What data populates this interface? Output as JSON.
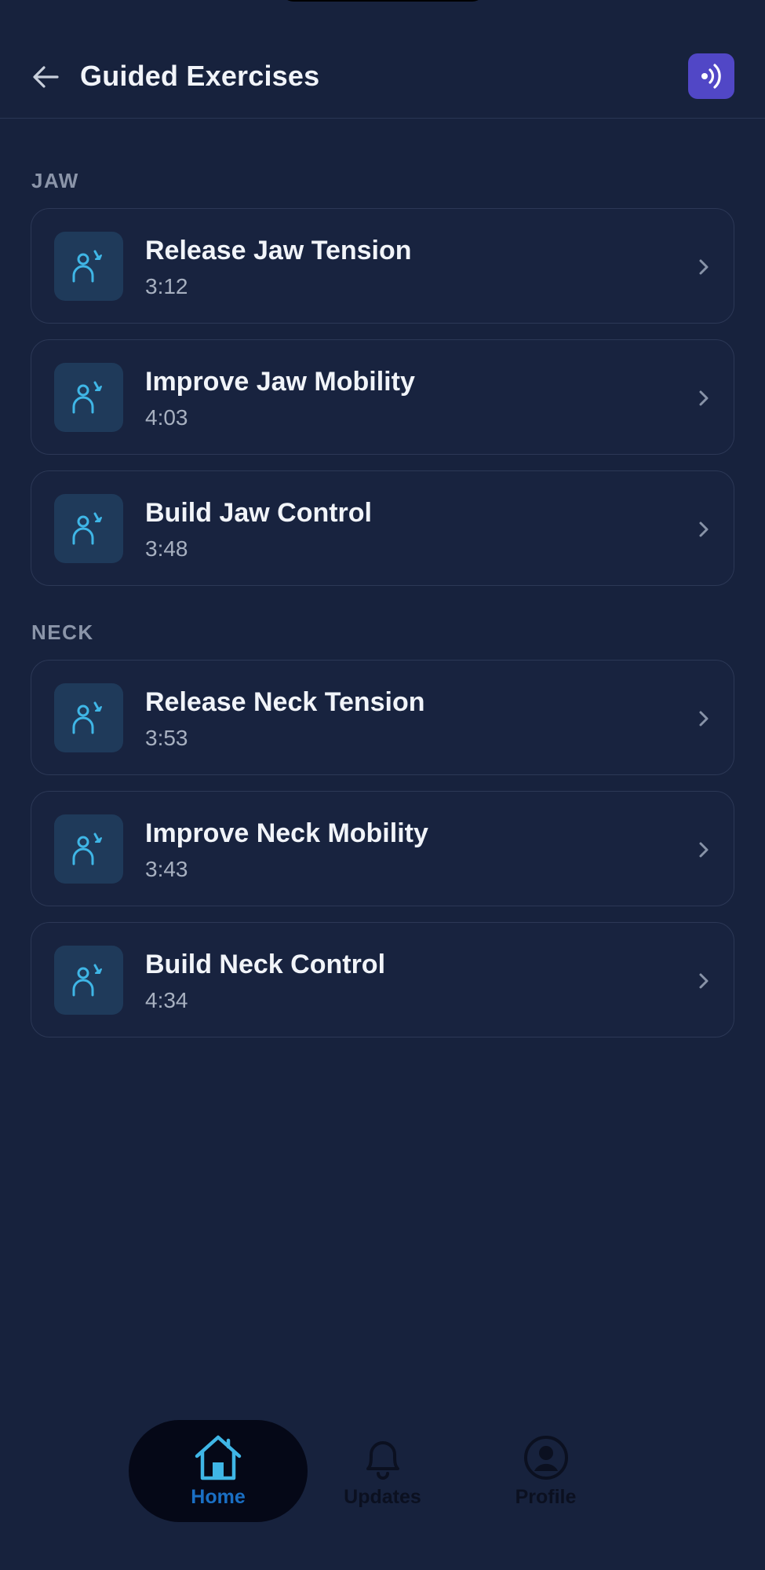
{
  "header": {
    "title": "Guided Exercises",
    "back_icon": "arrow-left-icon",
    "audio_icon": "audio-icon"
  },
  "sections": [
    {
      "label": "JAW",
      "items": [
        {
          "title": "Release Jaw Tension",
          "duration": "3:12"
        },
        {
          "title": "Improve Jaw Mobility",
          "duration": "4:03"
        },
        {
          "title": "Build Jaw Control",
          "duration": "3:48"
        }
      ]
    },
    {
      "label": "NECK",
      "items": [
        {
          "title": "Release Neck Tension",
          "duration": "3:53"
        },
        {
          "title": "Improve Neck Mobility",
          "duration": "3:43"
        },
        {
          "title": "Build Neck Control",
          "duration": "4:34"
        }
      ]
    }
  ],
  "tabbar": {
    "tabs": [
      {
        "label": "Home",
        "icon": "home-icon",
        "active": true
      },
      {
        "label": "Updates",
        "icon": "bell-icon",
        "active": false
      },
      {
        "label": "Profile",
        "icon": "profile-icon",
        "active": false
      }
    ]
  },
  "colors": {
    "background": "#17223d",
    "accent_purple": "#5147c6",
    "accent_cyan": "#3fb6e6",
    "active_tab_text": "#1a6fc4"
  }
}
